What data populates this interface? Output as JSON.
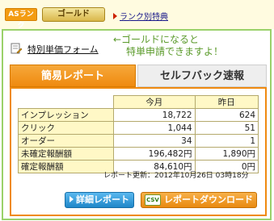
{
  "rank_bar": {
    "badge": "ASランク",
    "gold_button": "ゴールド",
    "rank_link": "ランク別特典"
  },
  "panel": {
    "form_link": "特別単価フォーム",
    "note_line1": "←ゴールドになると",
    "note_line2": "特単申請できますよ！"
  },
  "tabs": [
    {
      "label": "簡易レポート",
      "active": true
    },
    {
      "label": "セルフバック速報",
      "active": false
    }
  ],
  "report": {
    "headers": [
      "今月",
      "昨日"
    ],
    "rows": [
      {
        "label": "インプレッション",
        "month": "18,722",
        "yesterday": "624"
      },
      {
        "label": "クリック",
        "month": "1,044",
        "yesterday": "51"
      },
      {
        "label": "オーダー",
        "month": "34",
        "yesterday": "1"
      },
      {
        "label": "未確定報酬額",
        "month": "196,482円",
        "yesterday": "1,890円"
      },
      {
        "label": "確定報酬額",
        "month": "84,610円",
        "yesterday": "0円"
      }
    ],
    "updated": "レポート更新：2012年10月26日 03時18分"
  },
  "buttons": {
    "detail": "詳細レポート",
    "csv_icon": "CSV",
    "csv": "レポートダウンロード"
  },
  "colors": {
    "accent_orange": "#ef8a10",
    "panel_green": "#9ad16a",
    "note_green": "#5a9a2a",
    "detail_blue": "#1f87c9"
  }
}
